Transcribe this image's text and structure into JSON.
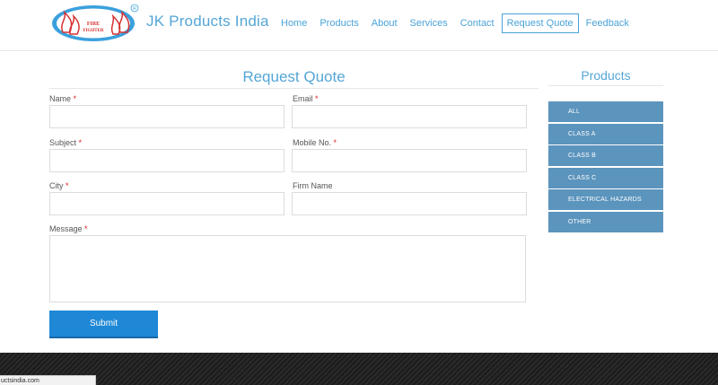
{
  "header": {
    "brand": "JK Products India",
    "logo_text_top": "FIRE",
    "logo_text_bottom": "FIGHTER",
    "registered_mark": "®",
    "nav": [
      {
        "label": "Home"
      },
      {
        "label": "Products"
      },
      {
        "label": "About"
      },
      {
        "label": "Services"
      },
      {
        "label": "Contact"
      },
      {
        "label": "Request Quote",
        "active": true
      },
      {
        "label": "Feedback"
      }
    ]
  },
  "form": {
    "title": "Request Quote",
    "required_mark": "*",
    "fields": {
      "name": {
        "label": "Name",
        "value": ""
      },
      "email": {
        "label": "Email",
        "value": ""
      },
      "subject": {
        "label": "Subject",
        "value": ""
      },
      "mobile": {
        "label": "Mobile No.",
        "value": ""
      },
      "city": {
        "label": "City",
        "value": ""
      },
      "firm": {
        "label": "Firm Name",
        "value": ""
      },
      "message": {
        "label": "Message",
        "value": ""
      }
    },
    "submit_label": "Submit"
  },
  "sidebar": {
    "title": "Products",
    "items": [
      {
        "label": "ALL"
      },
      {
        "label": "CLASS A"
      },
      {
        "label": "CLASS B"
      },
      {
        "label": "CLASS C"
      },
      {
        "label": "ELECTRICAL HAZARDS"
      },
      {
        "label": "OTHER"
      }
    ]
  },
  "status_bar": {
    "url": "uctsindia.com"
  },
  "colors": {
    "accent": "#4aa3d8",
    "sidebar_bg": "#5b94bd",
    "button_bg": "#1e88d6",
    "required": "#dd2222",
    "logo_blue": "#3aa0dc",
    "logo_red": "#d63030"
  }
}
